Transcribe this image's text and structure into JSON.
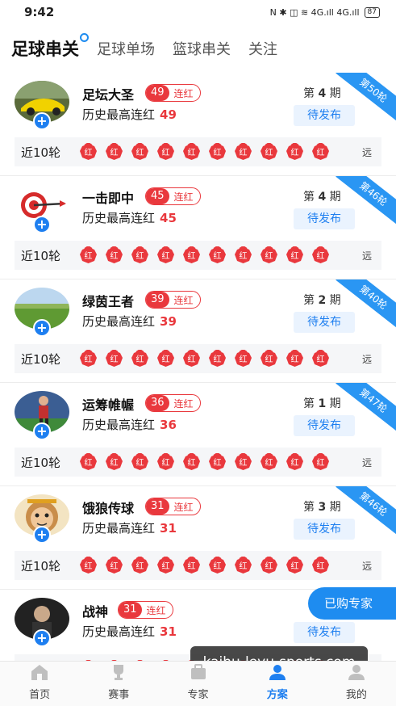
{
  "status_bar": {
    "time": "9:42",
    "icons": "N ✱ ◫ ≋ 4G.ıll 4G.ıll",
    "battery": "87"
  },
  "tabs": [
    {
      "label": "足球串关",
      "active": true
    },
    {
      "label": "足球单场",
      "active": false
    },
    {
      "label": "篮球串关",
      "active": false
    },
    {
      "label": "关注",
      "active": false
    }
  ],
  "labels": {
    "streak_suffix": "连红",
    "best_prefix": "历史最高连红",
    "period_prefix": "第",
    "period_suffix": "期",
    "pending": "待发布",
    "recent": "近10轮",
    "shield_text": "红",
    "more": "远"
  },
  "experts": [
    {
      "name": "足坛大圣",
      "streak": "49",
      "best": "49",
      "period": "4",
      "ribbon": "第50轮",
      "avatar": "car-avatar"
    },
    {
      "name": "一击即中",
      "streak": "45",
      "best": "45",
      "period": "4",
      "ribbon": "第46轮",
      "avatar": "target-avatar"
    },
    {
      "name": "绿茵王者",
      "streak": "39",
      "best": "39",
      "period": "2",
      "ribbon": "第40轮",
      "avatar": "field-avatar"
    },
    {
      "name": "运筹帷幄",
      "streak": "36",
      "best": "36",
      "period": "1",
      "ribbon": "第47轮",
      "avatar": "player-avatar"
    },
    {
      "name": "饿狼传球",
      "streak": "31",
      "best": "31",
      "period": "3",
      "ribbon": "第46轮",
      "avatar": "monkey-avatar"
    },
    {
      "name": "战神",
      "streak": "31",
      "best": "31",
      "period": "",
      "ribbon": "",
      "avatar": "man-avatar"
    }
  ],
  "float_button": "已购专家",
  "watermark": "kaihu-leyu-sports.com",
  "bottom_nav": [
    {
      "label": "首页",
      "icon": "home-icon",
      "active": false
    },
    {
      "label": "赛事",
      "icon": "trophy-icon",
      "active": false
    },
    {
      "label": "专家",
      "icon": "expert-icon",
      "active": false
    },
    {
      "label": "方案",
      "icon": "plan-icon",
      "active": true
    },
    {
      "label": "我的",
      "icon": "profile-icon",
      "active": false
    }
  ],
  "colors": {
    "accent": "#1e8cf0",
    "red": "#e9383d",
    "pending_bg": "#eaf3fe"
  }
}
